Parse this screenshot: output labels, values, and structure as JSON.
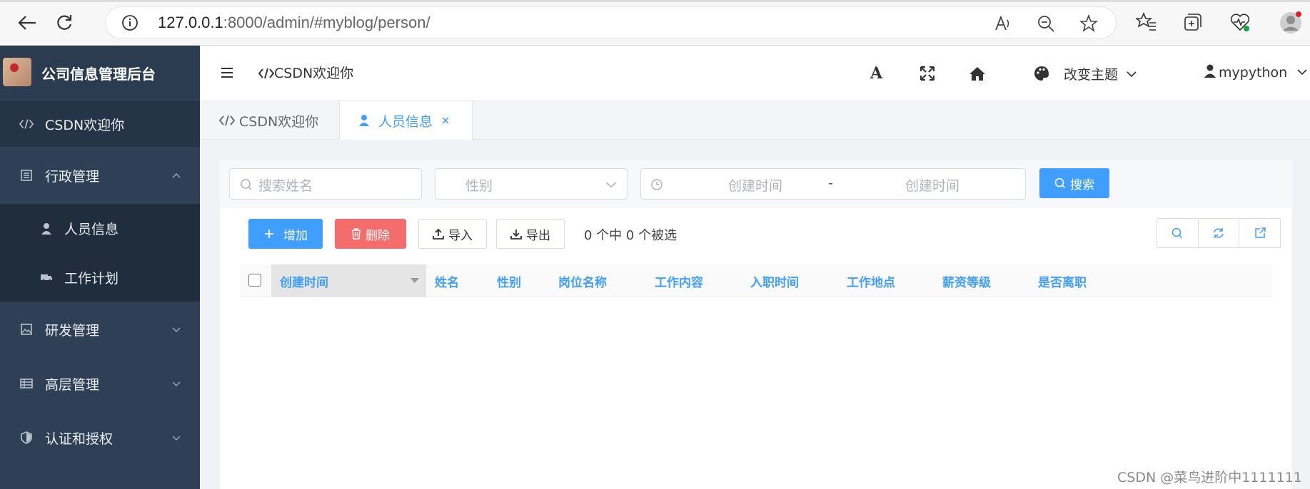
{
  "browser": {
    "url_host": "127.0.0.1",
    "url_rest": ":8000/admin/#myblog/person/"
  },
  "sidebar": {
    "app_title": "公司信息管理后台",
    "items": [
      {
        "label": "CSDN欢迎你"
      },
      {
        "label": "行政管理"
      },
      {
        "label": "人员信息"
      },
      {
        "label": "工作计划"
      },
      {
        "label": "研发管理"
      },
      {
        "label": "高层管理"
      },
      {
        "label": "认证和授权"
      }
    ]
  },
  "header": {
    "breadcrumb": "CSDN欢迎你",
    "font_icon_label": "A",
    "theme_label": "改变主题",
    "user_name": "mypython"
  },
  "tabs": [
    {
      "label": "CSDN欢迎你",
      "active": false
    },
    {
      "label": "人员信息",
      "active": true
    }
  ],
  "search": {
    "name_placeholder": "搜索姓名",
    "gender_placeholder": "性别",
    "date_start_placeholder": "创建时间",
    "date_separator": "-",
    "date_end_placeholder": "创建时间",
    "search_label": "搜索"
  },
  "toolbar": {
    "add_label": "增加",
    "delete_label": "删除",
    "import_label": "导入",
    "export_label": "导出",
    "selection_text": "0 个中 0 个被选"
  },
  "table": {
    "columns": [
      "创建时间",
      "姓名",
      "性别",
      "岗位名称",
      "工作内容",
      "入职时间",
      "工作地点",
      "薪资等级",
      "是否离职"
    ]
  },
  "watermark": "CSDN @菜鸟进阶中1111111",
  "colors": {
    "primary": "#409eff",
    "danger": "#f56c6c",
    "sidebar": "#2f4056"
  }
}
